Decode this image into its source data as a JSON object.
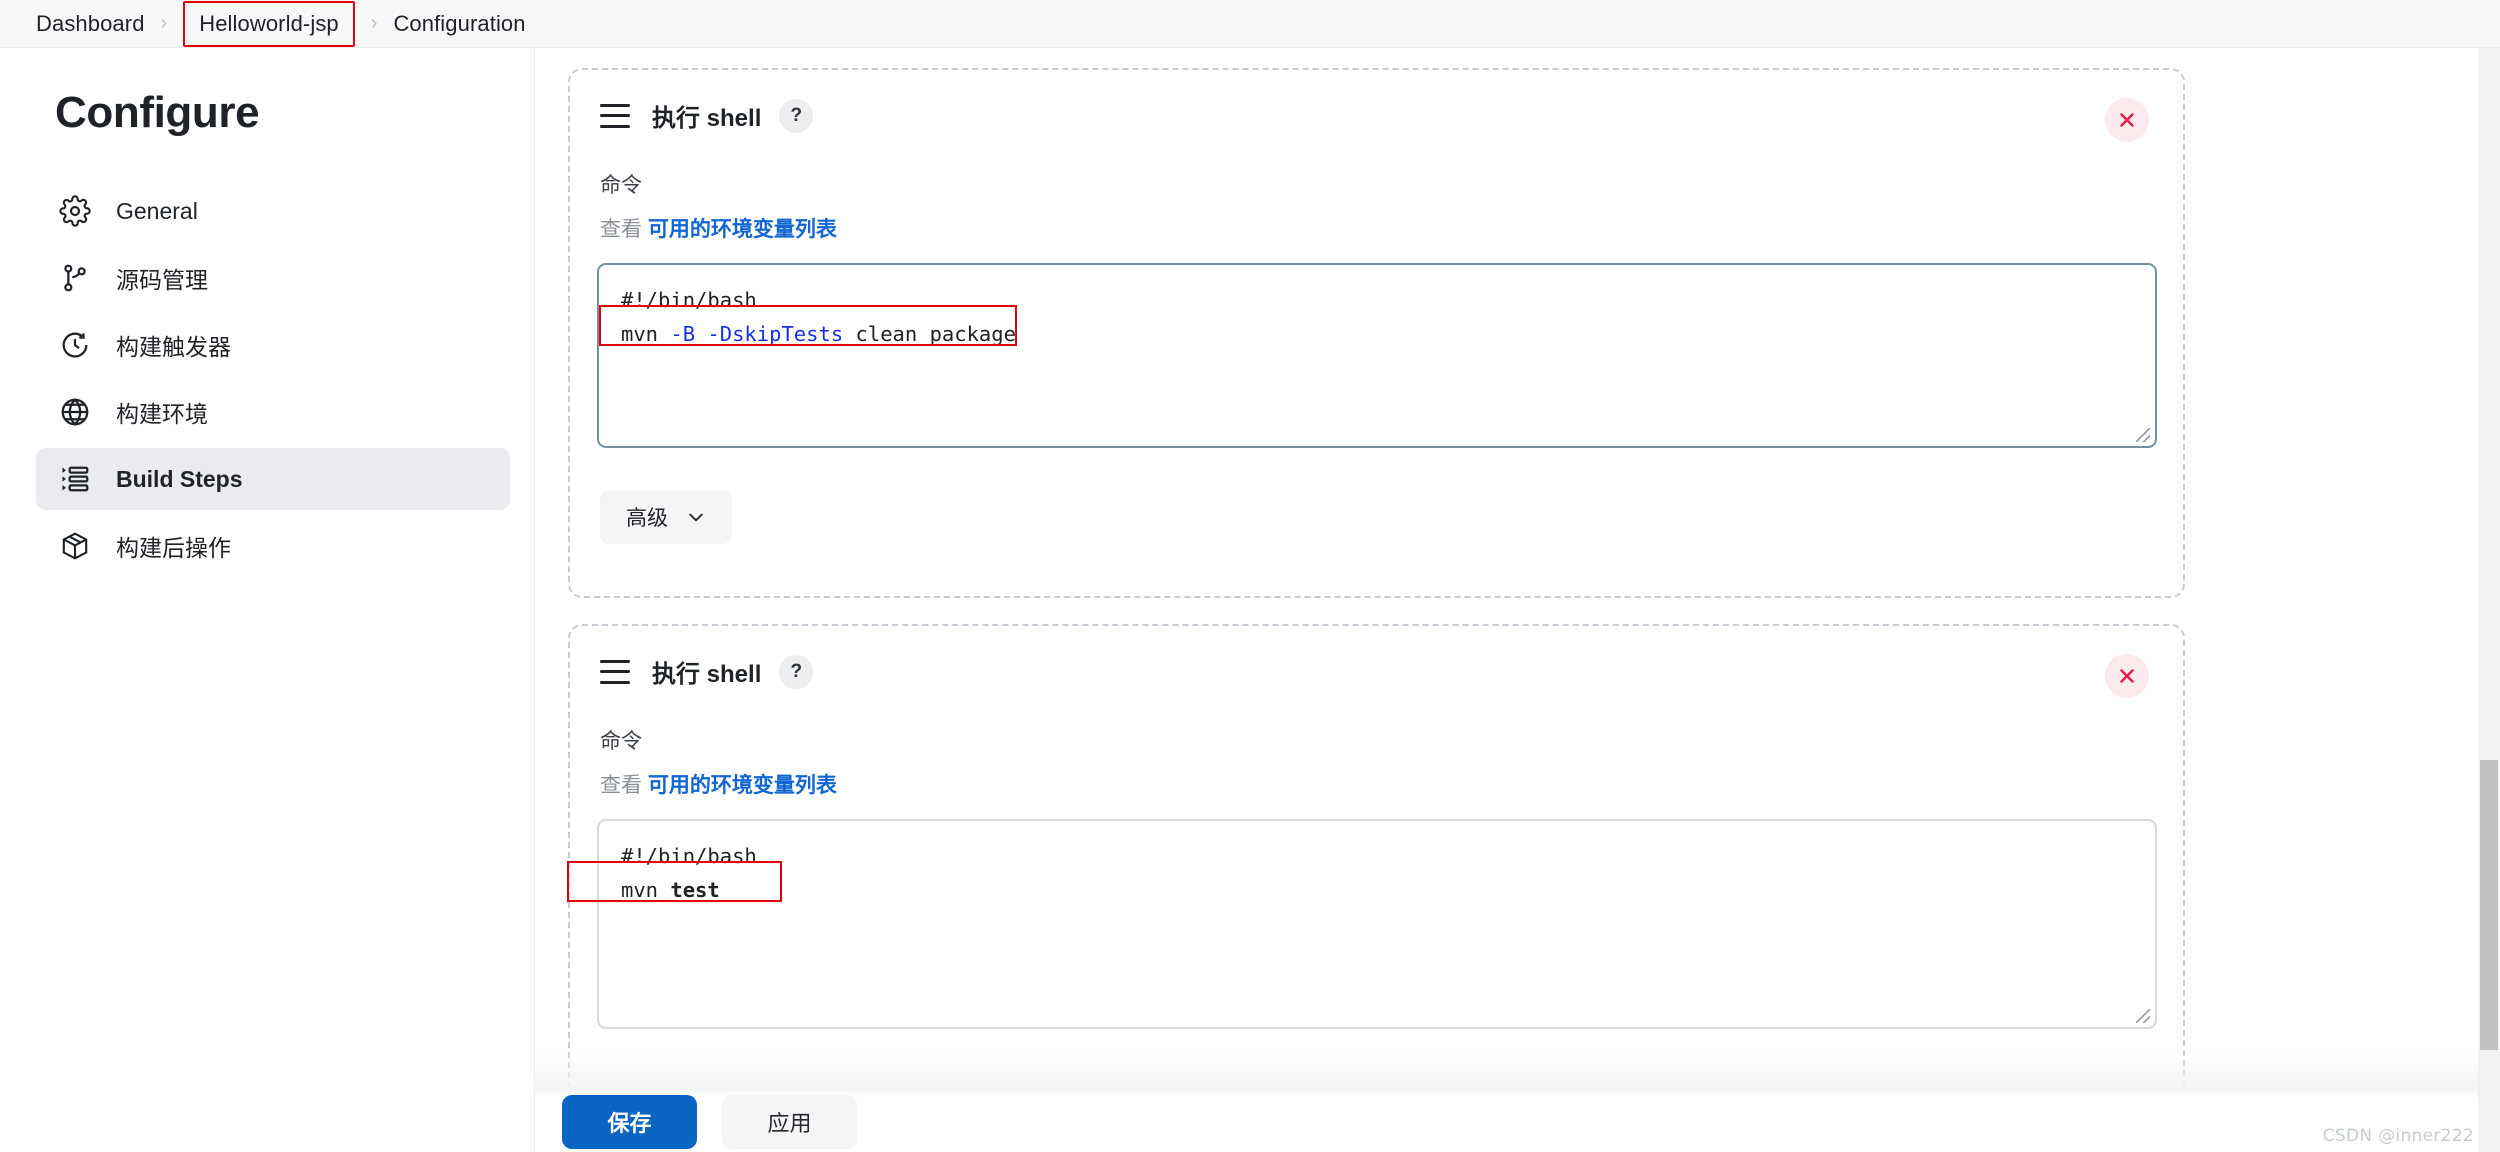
{
  "breadcrumb": {
    "items": [
      {
        "label": "Dashboard",
        "highlighted": false
      },
      {
        "label": "Helloworld-jsp",
        "highlighted": true
      },
      {
        "label": "Configuration",
        "highlighted": false
      }
    ],
    "separator": "›"
  },
  "sidebar": {
    "title": "Configure",
    "items": [
      {
        "label": "General",
        "icon": "gear-icon",
        "active": false
      },
      {
        "label": "源码管理",
        "icon": "git-branch-icon",
        "active": false
      },
      {
        "label": "构建触发器",
        "icon": "clock-icon",
        "active": false
      },
      {
        "label": "构建环境",
        "icon": "globe-icon",
        "active": false
      },
      {
        "label": "Build Steps",
        "icon": "list-steps-icon",
        "active": true
      },
      {
        "label": "构建后操作",
        "icon": "package-icon",
        "active": false
      }
    ]
  },
  "build_steps": [
    {
      "title": "执行 shell",
      "help_label": "?",
      "close_label": "×",
      "command_label": "命令",
      "env_prefix": "查看",
      "env_link": "可用的环境变量列表",
      "code": {
        "line1": "#!/bin/bash",
        "line2_plain_1": "mvn ",
        "line2_blue_1": "-B -DskipTests",
        "line2_plain_2": " clean package"
      },
      "advanced_label": "高级",
      "annotated": true
    },
    {
      "title": "执行 shell",
      "help_label": "?",
      "close_label": "×",
      "command_label": "命令",
      "env_prefix": "查看",
      "env_link": "可用的环境变量列表",
      "code": {
        "line1": "#!/bin/bash",
        "line2_plain_1": "mvn ",
        "line2_bold": "test"
      },
      "annotated": true
    }
  ],
  "actions": {
    "save_label": "保存",
    "apply_label": "应用"
  },
  "watermark": "CSDN @inner222",
  "colors": {
    "accent_blue": "#0b65c2",
    "link_blue": "#1166d3",
    "annotation_red": "#e8000d",
    "close_red": "#e8174a",
    "token_blue": "#1830e0",
    "panel_dash": "#c5ccd3",
    "sidebar_active_bg": "#e9ebee",
    "textarea_border_focus": "#7491a0"
  }
}
